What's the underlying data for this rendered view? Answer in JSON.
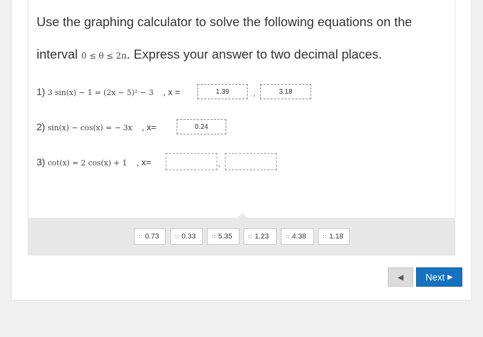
{
  "instructions": {
    "line1": "Use the graphing calculator to solve the following equations on the",
    "line2_prefix": "interval",
    "line2_interval": "0 ≤ θ ≤ 2π",
    "line2_suffix": ". Express your answer to two decimal places."
  },
  "equations": [
    {
      "number": "1)",
      "expression": "3 sin(x) − 1 = (2x − 5)² − 3",
      "x_label": ", x =",
      "answers": [
        "1.39",
        "3.18"
      ]
    },
    {
      "number": "2)",
      "expression": "sin(x) − cos(x) = − 3x",
      "x_label": ", x=",
      "answers": [
        "0.24"
      ]
    },
    {
      "number": "3)",
      "expression": "cot(x) = 2 cos(x) + 1",
      "x_label": ", x=",
      "answers": [
        "",
        ""
      ]
    }
  ],
  "separator": ",",
  "answer_bank": {
    "grip_icon": "∷",
    "choices": [
      "0.73",
      "0.33",
      "5.35",
      "1.23",
      "4.38",
      "1.18"
    ]
  },
  "navigation": {
    "prev_icon": "◀",
    "next_label": "Next",
    "next_icon": "▶"
  },
  "colors": {
    "next_button": "#1672c0",
    "bank_background": "#e8e8e8"
  }
}
